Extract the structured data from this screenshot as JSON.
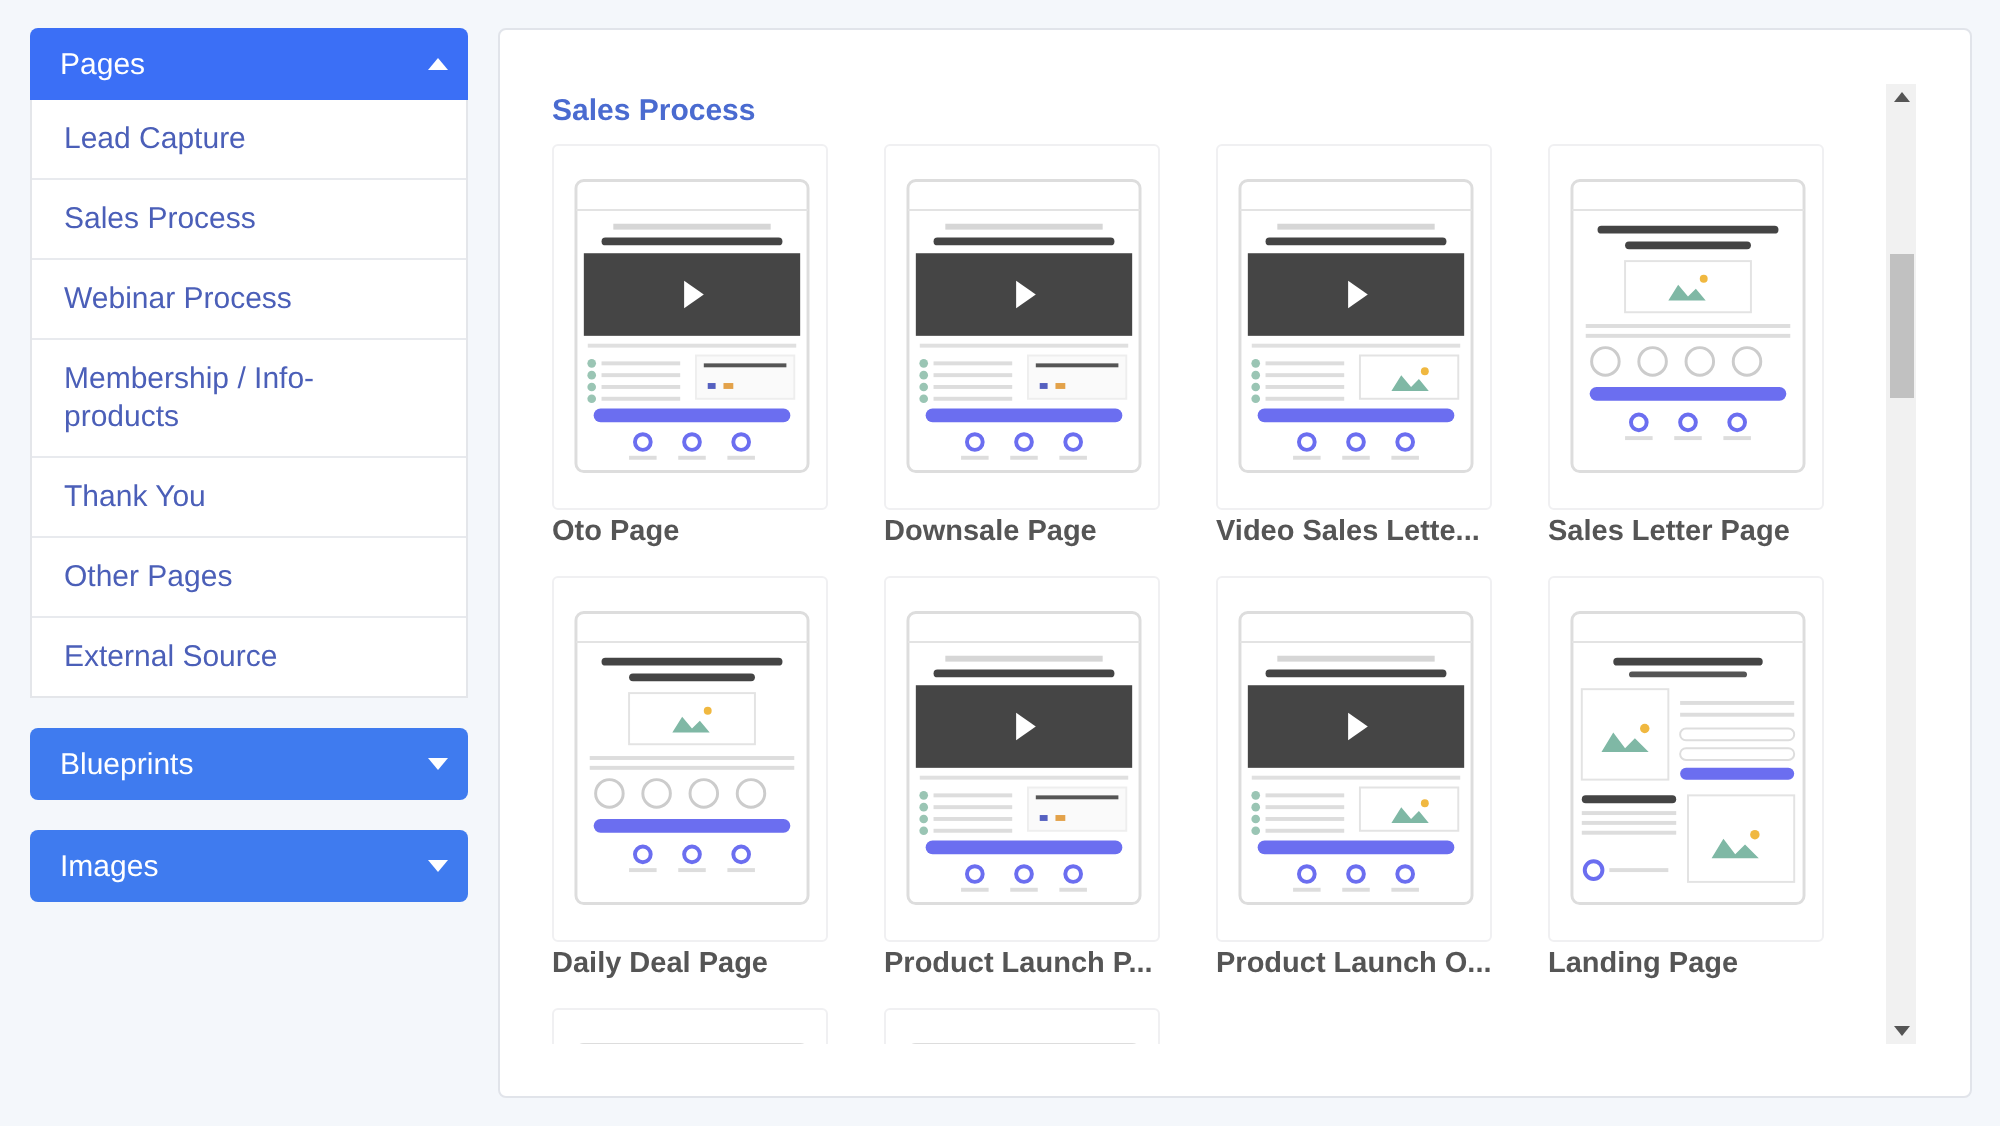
{
  "sidebar": {
    "sections": [
      {
        "title": "Pages",
        "expanded": true,
        "items": [
          "Lead Capture",
          "Sales Process",
          "Webinar Process",
          "Membership / Info-products",
          "Thank You",
          "Other Pages",
          "External Source"
        ]
      },
      {
        "title": "Blueprints",
        "expanded": false
      },
      {
        "title": "Images",
        "expanded": false
      }
    ]
  },
  "main": {
    "title": "Sales Process",
    "templates": [
      {
        "label": "Oto Page",
        "kind": "video"
      },
      {
        "label": "Downsale Page",
        "kind": "video"
      },
      {
        "label": "Video Sales Lette...",
        "kind": "video-image"
      },
      {
        "label": "Sales Letter Page",
        "kind": "image"
      },
      {
        "label": "Daily Deal Page",
        "kind": "image"
      },
      {
        "label": "Product Launch P...",
        "kind": "video"
      },
      {
        "label": "Product Launch O...",
        "kind": "video-image"
      },
      {
        "label": "Landing Page",
        "kind": "landing"
      },
      {
        "kind": "blank"
      },
      {
        "kind": "blank"
      }
    ]
  }
}
